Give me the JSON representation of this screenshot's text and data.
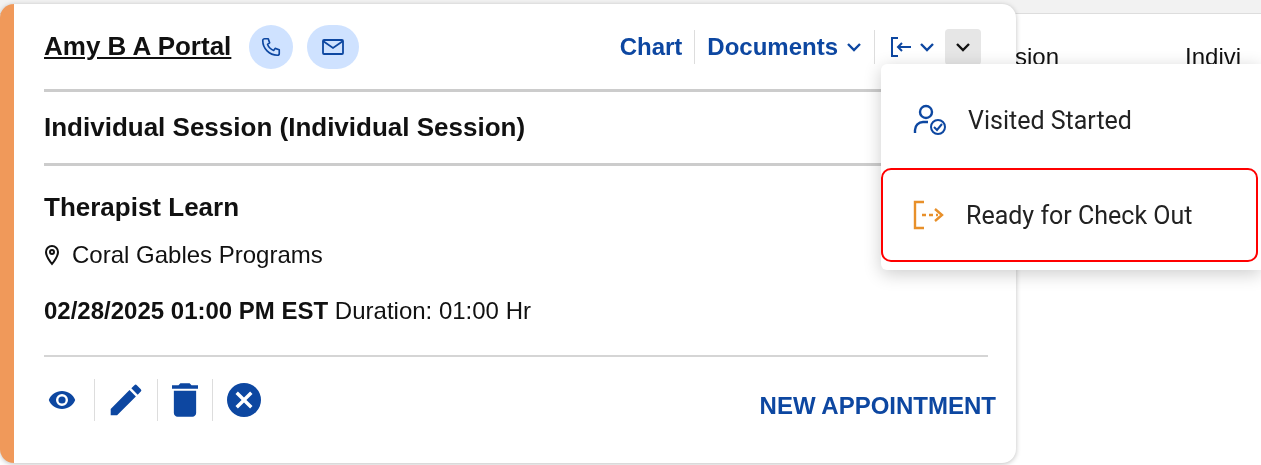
{
  "background_table": {
    "columns": [
      "sion",
      "Indivi"
    ]
  },
  "card": {
    "patient_name": "Amy B A Portal",
    "nav": [
      {
        "label": "Chart",
        "kind": "link"
      },
      {
        "label": "Documents",
        "kind": "dropdown"
      }
    ],
    "status_button": {
      "expanded": true
    },
    "session_title": "Individual Session (Individual Session)",
    "therapist": "Therapist Learn",
    "location": "Coral Gables Programs",
    "schedule": "**02/28/2025 01:00 PM EST** Duration: 01:00 Hr",
    "new_appointment": "NEW APPOINTMENT"
  },
  "status_menu": {
    "items": [
      {
        "label": "Visited Started",
        "kind": "visit",
        "selected": false
      },
      {
        "label": "Ready for Check Out",
        "kind": "checkout",
        "selected": true
      }
    ]
  }
}
